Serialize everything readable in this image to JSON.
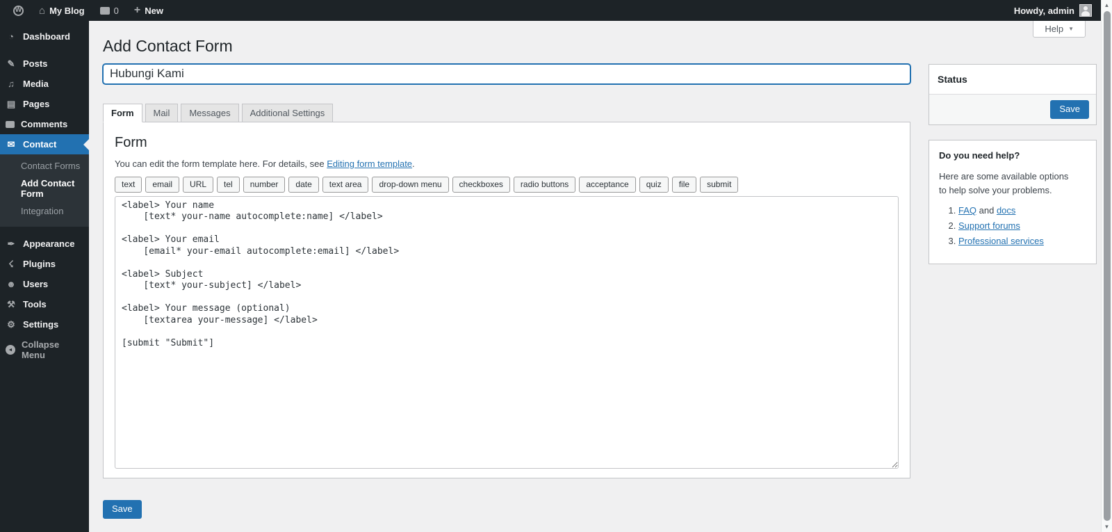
{
  "admin_bar": {
    "site_name": "My Blog",
    "comment_count": "0",
    "new_label": "New",
    "howdy": "Howdy, admin"
  },
  "help_tab": {
    "label": "Help"
  },
  "sidebar": {
    "items": [
      {
        "id": "dashboard",
        "label": "Dashboard",
        "icon": "dashboard-icon"
      },
      {
        "id": "posts",
        "label": "Posts",
        "icon": "posts-icon",
        "separator_before": true
      },
      {
        "id": "media",
        "label": "Media",
        "icon": "media-icon"
      },
      {
        "id": "pages",
        "label": "Pages",
        "icon": "pages-icon"
      },
      {
        "id": "comments",
        "label": "Comments",
        "icon": "comments-icon"
      },
      {
        "id": "contact",
        "label": "Contact",
        "icon": "contact-icon",
        "active": true,
        "submenu": [
          {
            "label": "Contact Forms"
          },
          {
            "label": "Add Contact Form",
            "current": true
          },
          {
            "label": "Integration"
          }
        ]
      },
      {
        "id": "appearance",
        "label": "Appearance",
        "icon": "appearance-icon",
        "separator_before": true
      },
      {
        "id": "plugins",
        "label": "Plugins",
        "icon": "plugins-icon"
      },
      {
        "id": "users",
        "label": "Users",
        "icon": "users-icon"
      },
      {
        "id": "tools",
        "label": "Tools",
        "icon": "tools-icon"
      },
      {
        "id": "settings",
        "label": "Settings",
        "icon": "settings-icon"
      },
      {
        "id": "collapse",
        "label": "Collapse Menu",
        "icon": "collapse-icon"
      }
    ]
  },
  "page": {
    "title": "Add Contact Form",
    "form_title_value": "Hubungi Kami",
    "tabs": [
      "Form",
      "Mail",
      "Messages",
      "Additional Settings"
    ],
    "active_tab": "Form",
    "panel": {
      "heading": "Form",
      "description_prefix": "You can edit the form template here. For details, see ",
      "description_link": "Editing form template",
      "description_suffix": ".",
      "tag_buttons": [
        "text",
        "email",
        "URL",
        "tel",
        "number",
        "date",
        "text area",
        "drop-down menu",
        "checkboxes",
        "radio buttons",
        "acceptance",
        "quiz",
        "file",
        "submit"
      ],
      "form_template": "<label> Your name\n    [text* your-name autocomplete:name] </label>\n\n<label> Your email\n    [email* your-email autocomplete:email] </label>\n\n<label> Subject\n    [text* your-subject] </label>\n\n<label> Your message (optional)\n    [textarea your-message] </label>\n\n[submit \"Submit\"]"
    },
    "save_label": "Save"
  },
  "status_box": {
    "title": "Status",
    "save_label": "Save"
  },
  "help_box": {
    "title": "Do you need help?",
    "intro": "Here are some available options to help solve your problems.",
    "items": [
      {
        "parts": [
          {
            "text": "FAQ",
            "link": true
          },
          {
            "text": " and ",
            "link": false
          },
          {
            "text": "docs",
            "link": true
          }
        ]
      },
      {
        "parts": [
          {
            "text": "Support forums",
            "link": true
          }
        ]
      },
      {
        "parts": [
          {
            "text": "Professional services",
            "link": true
          }
        ]
      }
    ]
  },
  "colors": {
    "accent": "#2271b1",
    "sidebar_bg": "#1d2327",
    "submenu_bg": "#2c3338",
    "content_bg": "#f0f0f1",
    "link": "#2271b1"
  }
}
